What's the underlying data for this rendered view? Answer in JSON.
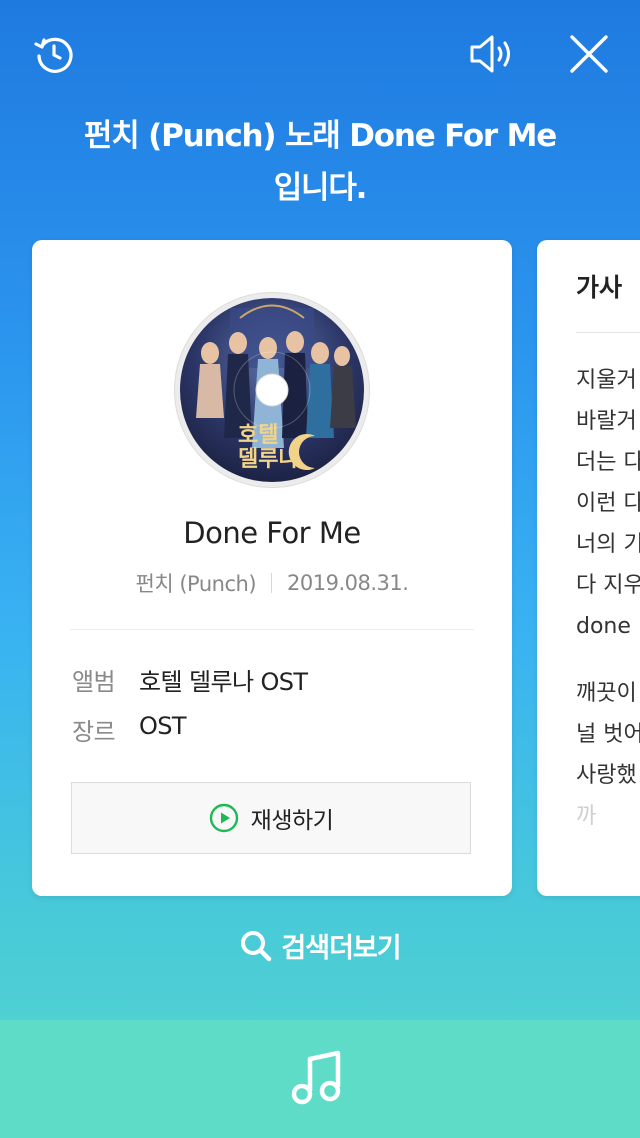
{
  "header": {
    "history_icon": "history-icon",
    "sound_icon": "speaker-icon",
    "close_icon": "close-icon"
  },
  "headline": {
    "line1": "펀치 (Punch) 노래 Done For Me",
    "line2": "입니다."
  },
  "song_card": {
    "title": "Done For Me",
    "artist": "펀치 (Punch)",
    "release_date": "2019.08.31.",
    "album_label": "앨범",
    "album_value": "호텔 델루나 OST",
    "genre_label": "장르",
    "genre_value": "OST",
    "play_label": "재생하기",
    "album_art_text": "호텔 델루나"
  },
  "lyrics_card": {
    "title": "가사",
    "lines": [
      "지울거",
      "바랄거",
      "더는 다",
      "이런 다",
      "너의 기",
      "다 지우",
      "done",
      "",
      "깨끗이",
      "널 벗어",
      "사랑했",
      "까"
    ]
  },
  "search_more": {
    "label": "검색더보기"
  },
  "bottom_bar": {
    "icon": "music-note-icon"
  },
  "colors": {
    "accent_green": "#1db954",
    "gradient_top": "#1f7ae0",
    "gradient_bottom": "#58d6cc"
  }
}
